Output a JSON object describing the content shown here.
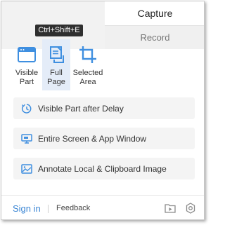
{
  "tabs": {
    "capture_label": "Capture",
    "record_label": "Record"
  },
  "tooltip": {
    "text": "Ctrl+Shift+E"
  },
  "modes": [
    {
      "label_line1": "Visible",
      "label_line2": "Part",
      "icon": "browser-window-icon"
    },
    {
      "label_line1": "Full",
      "label_line2": "Page",
      "icon": "full-page-icon"
    },
    {
      "label_line1": "Selected",
      "label_line2": "Area",
      "icon": "crop-icon"
    }
  ],
  "actions": [
    {
      "label": "Visible Part after Delay",
      "icon": "delay-timer-icon"
    },
    {
      "label": "Entire Screen & App Window",
      "icon": "monitor-icon"
    },
    {
      "label": "Annotate Local & Clipboard Image",
      "icon": "image-icon"
    }
  ],
  "footer": {
    "signin_label": "Sign in",
    "feedback_label": "Feedback"
  },
  "colors": {
    "accent": "#3b86d4",
    "active_mode_bg": "#e4ecf8",
    "icon_blue": "#3f8fe0"
  }
}
